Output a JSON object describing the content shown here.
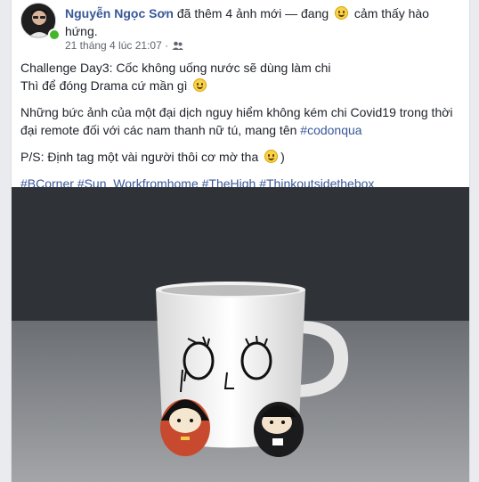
{
  "header": {
    "author": "Nguyễn Ngọc Sơn",
    "action_text": "đã thêm 4 ảnh mới — đang",
    "feeling_text": "cảm thấy hào hứng."
  },
  "meta": {
    "timestamp": "21 tháng 4 lúc 21:07 ·",
    "audience_icon": "friends-icon"
  },
  "post": {
    "line1": "Challenge Day3: Cốc không uống nước sẽ dùng làm chi",
    "line2": "Thì để đóng Drama cứ mần gì",
    "paragraph2": "Những bức ảnh của một đại dịch nguy hiểm không kém chi Covid19 trong thời đại remote đối với các nam thanh nữ tú, mang tên",
    "paragraph2_tag": "#codonqua",
    "paragraph3": "P/S: Định tag một vài người thôi cơ mờ tha",
    "hashtags": [
      "#BCorner",
      "#Sun_Workfromhome",
      "#TheHigh",
      "#Thinkoutsidethebox"
    ]
  },
  "photo": {
    "subject": "white mug with cartoon face and two wooden kokeshi figures"
  }
}
